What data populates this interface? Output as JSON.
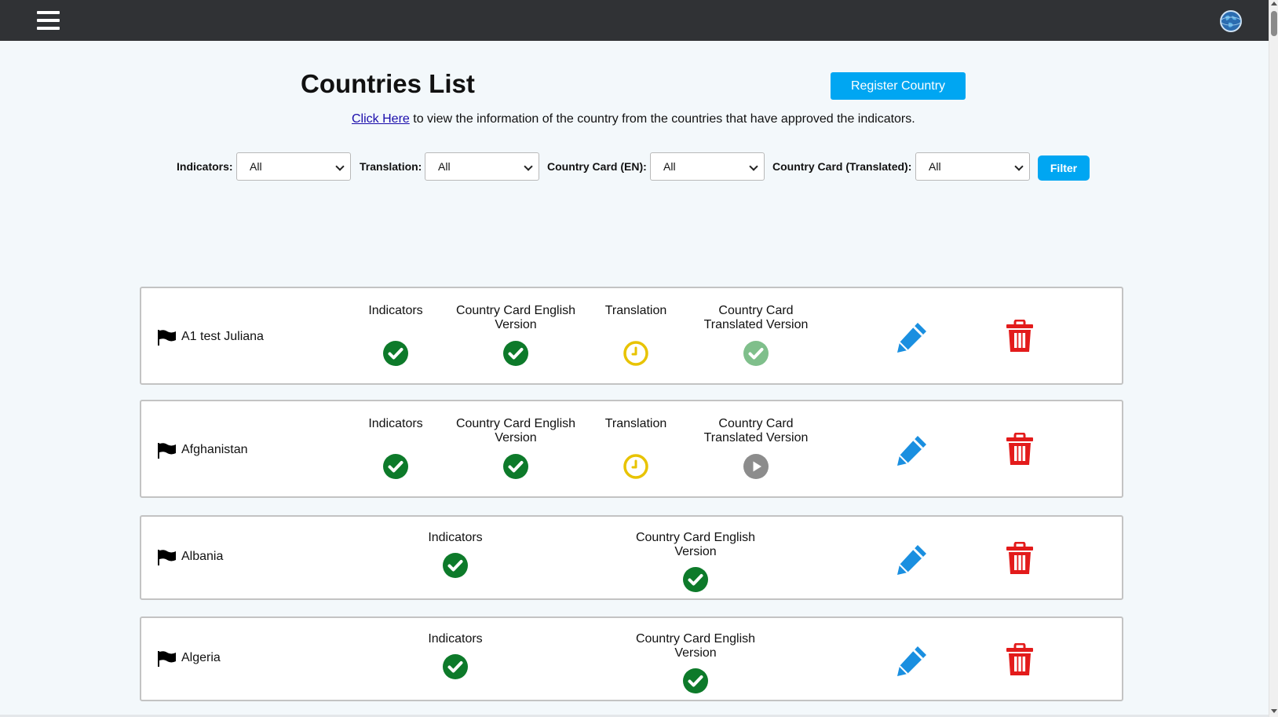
{
  "topbar": {
    "menu_icon": "hamburger-menu-icon",
    "globe_icon": "globe-icon"
  },
  "header": {
    "title": "Countries List",
    "register_label": "Register Country",
    "info_link": "Click Here",
    "info_text": " to view the information of the country from the countries that have approved the indicators."
  },
  "filters": {
    "indicators_label": "Indicators:",
    "indicators_value": "All",
    "translation_label": "Translation:",
    "translation_value": "All",
    "card_en_label": "Country Card (EN):",
    "card_en_value": "All",
    "card_tr_label": "Country Card (Translated):",
    "card_tr_value": "All",
    "filter_label": "Filter"
  },
  "colors": {
    "accent": "#00a6f2",
    "topbar": "#303235",
    "approved": "#0d7a2a",
    "approved_light": "#7fbf8b",
    "pending": "#e8c300",
    "not_started": "#8c8c8c",
    "edit": "#1a8fe0",
    "delete": "#e31b1b"
  },
  "countries": [
    {
      "name": "A1 test Juliana",
      "columns": [
        {
          "label": "Indicators",
          "status": "approved"
        },
        {
          "label": "Country Card English Version",
          "status": "approved"
        },
        {
          "label": "Translation",
          "status": "pending"
        },
        {
          "label": "Country Card Translated Version",
          "status": "approved-light"
        }
      ]
    },
    {
      "name": "Afghanistan",
      "columns": [
        {
          "label": "Indicators",
          "status": "approved"
        },
        {
          "label": "Country Card English Version",
          "status": "approved"
        },
        {
          "label": "Translation",
          "status": "pending"
        },
        {
          "label": "Country Card Translated Version",
          "status": "not-started"
        }
      ]
    },
    {
      "name": "Albania",
      "columns": [
        {
          "label": "Indicators",
          "status": "approved"
        },
        {
          "label": "Country Card English Version",
          "status": "approved"
        }
      ]
    },
    {
      "name": "Algeria",
      "columns": [
        {
          "label": "Indicators",
          "status": "approved"
        },
        {
          "label": "Country Card English Version",
          "status": "approved"
        }
      ]
    }
  ]
}
